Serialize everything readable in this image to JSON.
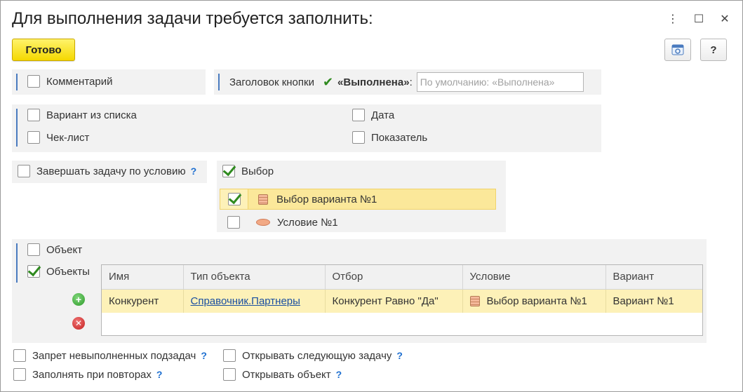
{
  "window": {
    "title": "Для выполнения задачи требуется заполнить:",
    "more_icon": "⋮",
    "maximize_icon": "☐",
    "close_icon": "✕"
  },
  "toolbar": {
    "done_label": "Готово",
    "help_label": "?"
  },
  "comment": {
    "label": "Комментарий",
    "checked": false
  },
  "button_caption": {
    "label": "Заголовок кнопки",
    "value": "«Выполнена»",
    "colon": ":",
    "placeholder": "По умолчанию: «Выполнена»"
  },
  "fields": {
    "variant_list": {
      "label": "Вариант из списка",
      "checked": false
    },
    "date": {
      "label": "Дата",
      "checked": false
    },
    "checklist": {
      "label": "Чек-лист",
      "checked": false
    },
    "indicator": {
      "label": "Показатель",
      "checked": false
    }
  },
  "complete_by_condition": {
    "label": "Завершать задачу по условию",
    "help": "?",
    "checked": false
  },
  "choice": {
    "label": "Выбор",
    "checked": true,
    "items": [
      {
        "label": "Выбор варианта №1",
        "checked": true,
        "icon": "condition-icon"
      },
      {
        "label": "Условие №1",
        "checked": false,
        "icon": "oval-icon"
      }
    ]
  },
  "objects": {
    "object_label": "Объект",
    "objects_label": "Объекты",
    "objects_checked": true,
    "columns": [
      "Имя",
      "Тип объекта",
      "Отбор",
      "Условие",
      "Вариант"
    ],
    "rows": [
      {
        "name": "Конкурент",
        "type": "Справочник.Партнеры",
        "filter": "Конкурент Равно \"Да\"",
        "condition": "Выбор варианта №1",
        "variant": "Вариант №1"
      }
    ]
  },
  "options": {
    "forbid_unfinished": {
      "label": "Запрет невыполненных подзадач",
      "help": "?"
    },
    "fill_on_repeat": {
      "label": "Заполнять при повторах",
      "help": "?"
    },
    "open_next_task": {
      "label": "Открывать следующую задачу",
      "help": "?"
    },
    "open_object": {
      "label": "Открывать объект",
      "help": "?"
    }
  },
  "colors": {
    "accent": "#f5d800",
    "selection": "#fbe89a",
    "link": "#1a4fa0",
    "help": "#1e6fd0",
    "check": "#2f8a1f"
  }
}
